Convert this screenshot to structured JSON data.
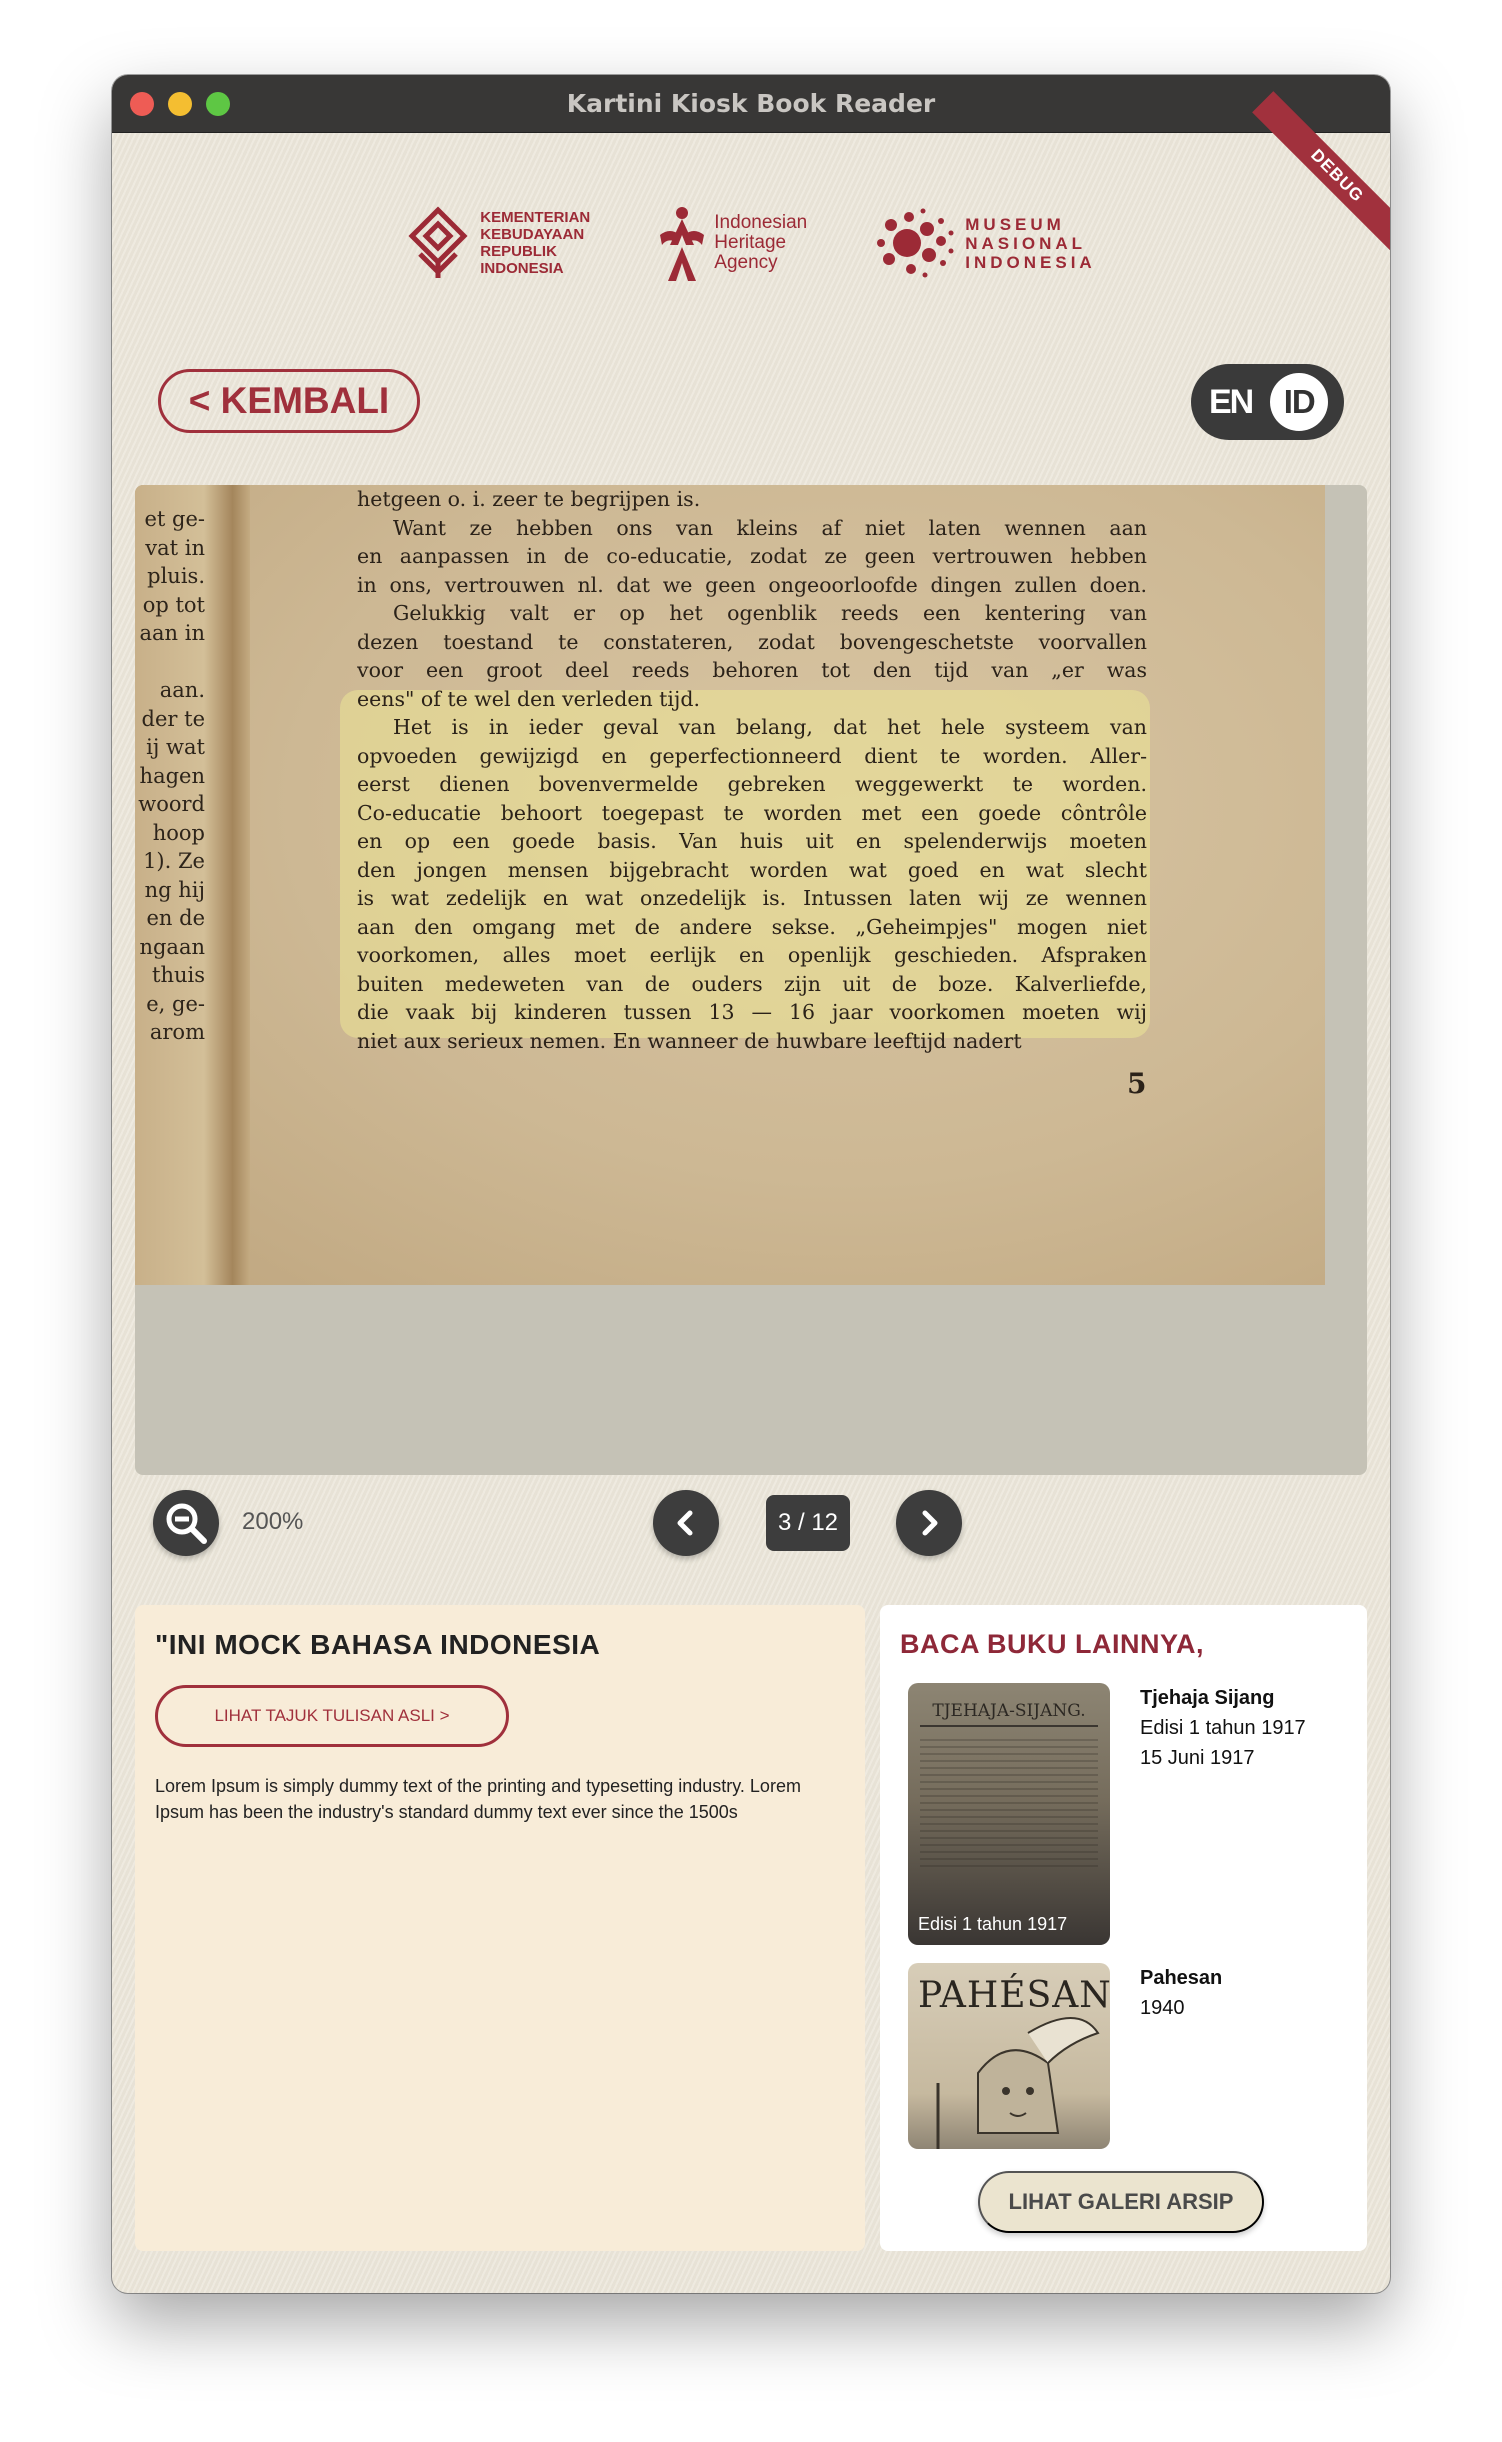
{
  "window": {
    "title": "Kartini Kiosk Book Reader"
  },
  "debug_label": "DEBUG",
  "logos": {
    "ministry": "KEMENTERIAN\nKEBUDAYAAN\nREPUBLIK\nINDONESIA",
    "agency": "Indonesian\nHeritage\nAgency",
    "museum": "MUSEUM\nNASIONAL\nINDONESIA"
  },
  "header": {
    "back_label": "< KEMBALI",
    "lang_en": "EN",
    "lang_id": "ID",
    "active_lang": "ID"
  },
  "document": {
    "left_column": "et ge-\nvat in\n pluis.\nop tot\naan in\n\n aan.\nder te\nij wat\nhagen\nwoord\n hoop\n1). Ze\nng hij\nen de\nngaan\n thuis\ne, ge-\narom",
    "lines": [
      "hetgeen o. i. zeer te begrijpen is.",
      "Want ze hebben ons van kleins af niet laten wennen aan",
      "en aanpassen in de co-educatie, zodat ze geen vertrouwen hebben",
      "in ons, vertrouwen nl. dat we geen ongeoorloofde dingen zullen doen.",
      "Gelukkig valt er op het ogenblik reeds een kentering van",
      "dezen toestand te constateren, zodat bovengeschetste voorvallen",
      "voor een groot deel reeds behoren tot den tijd van „er was",
      "eens\" of te wel den verleden tijd.",
      "Het is in ieder geval van belang, dat het hele systeem van",
      "opvoeden gewijzigd en geperfectionneerd dient te worden. Aller-",
      "eerst dienen bovenvermelde gebreken weggewerkt te worden.",
      "Co-educatie behoort toegepast te worden met een goede côntrôle",
      "en op een goede basis. Van huis uit en spelenderwijs moeten",
      "den jongen mensen bijgebracht worden wat goed en wat slecht",
      "is wat zedelijk en wat onzedelijk is. Intussen laten wij ze wennen",
      "aan den omgang met de andere sekse. „Geheimpjes\" mogen niet",
      "voorkomen, alles moet eerlijk en openlijk geschieden. Afspraken",
      "buiten medeweten van de ouders zijn uit de boze. Kalverliefde,",
      "die vaak bij kinderen tussen 13 — 16 jaar voorkomen moeten wij",
      "niet aux serieux nemen. En wanneer de huwbare leeftijd nadert"
    ],
    "page_number": "5"
  },
  "controls": {
    "zoom": "200%",
    "page_indicator": "3 / 12"
  },
  "info": {
    "title": "\"INI MOCK BAHASA INDONESIA",
    "original_button": "LIHAT TAJUK TULISAN ASLI >",
    "body": "Lorem Ipsum is simply dummy text of the printing and typesetting industry. Lorem Ipsum has been the industry's standard dummy text ever since the 1500s"
  },
  "more": {
    "title": "BACA BUKU LAINNYA,",
    "books": [
      {
        "cover_title": "TJEHAJA-SIJANG.",
        "caption": "Edisi 1 tahun 1917",
        "title": "Tjehaja Sijang",
        "line1": "Edisi 1 tahun 1917",
        "line2": "15 Juni 1917"
      },
      {
        "cover_title": "PAHÉSAN",
        "title": "Pahesan",
        "line1": "1940"
      }
    ],
    "gallery_button": "LIHAT GALERI ARSIP"
  },
  "colors": {
    "brand": "#a0303c",
    "panel_cream": "#f8ecd8",
    "dark": "#3d3d3d"
  }
}
